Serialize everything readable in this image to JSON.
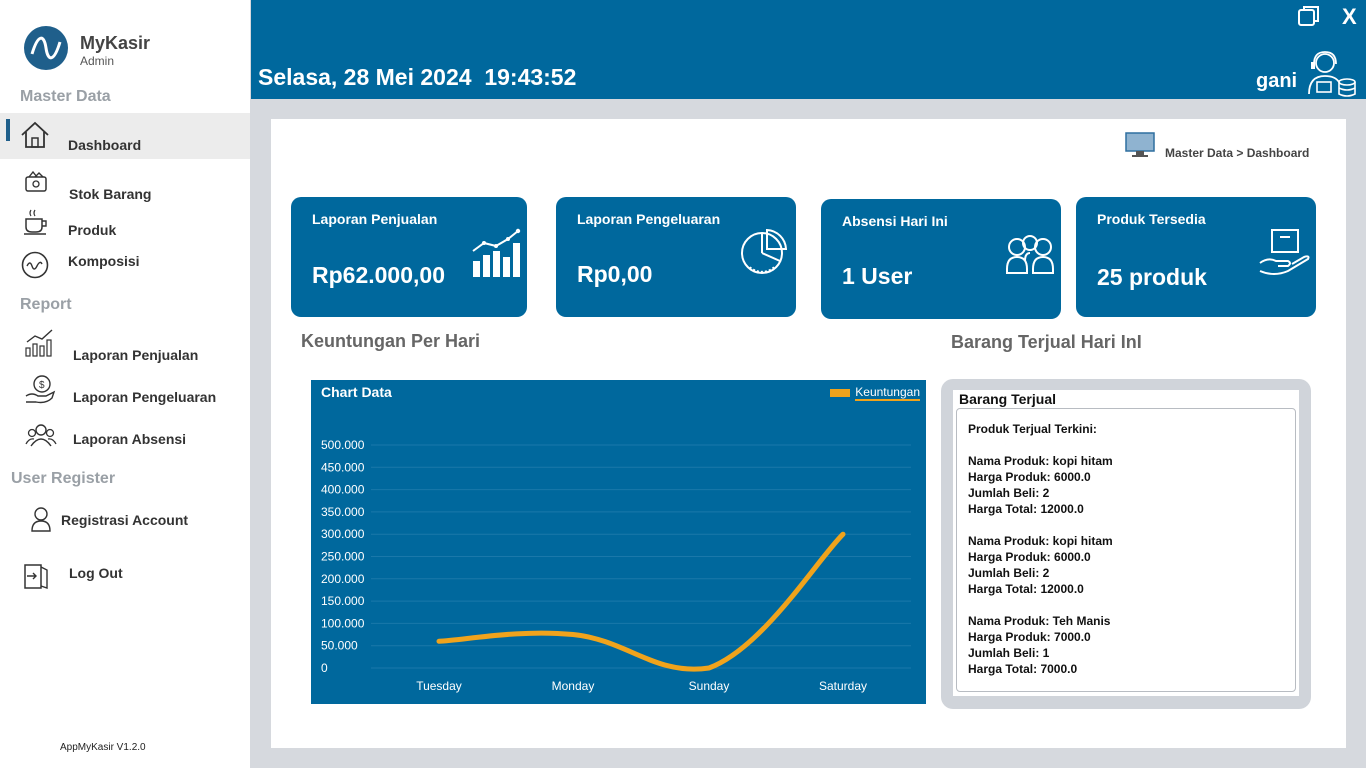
{
  "app": {
    "name": "MyKasir",
    "role": "Admin",
    "version": "AppMyKasir V1.2.0"
  },
  "sidebar": {
    "sections": {
      "master": "Master Data",
      "report": "Report",
      "user": "User Register"
    },
    "items": [
      {
        "label": "Dashboard",
        "icon": "home-icon",
        "active": true
      },
      {
        "label": "Stok Barang",
        "icon": "stock-icon"
      },
      {
        "label": "Produk",
        "icon": "coffee-icon"
      },
      {
        "label": "Komposisi",
        "icon": "wave-icon"
      },
      {
        "label": "Laporan Penjualan",
        "icon": "bar-chart-icon"
      },
      {
        "label": "Laporan Pengeluaran",
        "icon": "money-hand-icon"
      },
      {
        "label": "Laporan Absensi",
        "icon": "people-icon"
      },
      {
        "label": "Registrasi Account",
        "icon": "user-icon"
      },
      {
        "label": "Log Out",
        "icon": "logout-icon"
      }
    ]
  },
  "header": {
    "datetime": "Selasa, 28 Mei 2024  19:43:52",
    "username": "gani",
    "close_label": "X"
  },
  "breadcrumb": "Master Data > Dashboard",
  "cards": [
    {
      "title": "Laporan Penjualan",
      "value": "Rp62.000,00",
      "icon": "sales-chart-icon"
    },
    {
      "title": "Laporan Pengeluaran",
      "value": "Rp0,00",
      "icon": "pie-chart-icon"
    },
    {
      "title": "Absensi Hari Ini",
      "value": "1 User",
      "icon": "users-icon"
    },
    {
      "title": "Produk Tersedia",
      "value": "25 produk",
      "icon": "box-hand-icon"
    }
  ],
  "headings": {
    "profit": "Keuntungan Per Hari",
    "sold": "Barang Terjual Hari InI"
  },
  "chart_data": {
    "type": "line",
    "title": "Chart Data",
    "series": [
      {
        "name": "Keuntungan",
        "values": [
          60000,
          75000,
          0,
          300000
        ],
        "color": "#f0a31c"
      }
    ],
    "categories": [
      "Tuesday",
      "Monday",
      "Sunday",
      "Saturday"
    ],
    "y_ticks": [
      "500.000",
      "450.000",
      "400.000",
      "350.000",
      "300.000",
      "250.000",
      "200.000",
      "150.000",
      "100.000",
      "50.000",
      "0"
    ],
    "ylim": [
      0,
      500000
    ],
    "grid": true,
    "legend": "top-right"
  },
  "sold": {
    "title": "Barang Terjual",
    "header": "Produk Terjual Terkini:",
    "items": [
      {
        "nama": "Nama Produk: kopi hitam",
        "harga": "Harga Produk: 6000.0",
        "jumlah": "Jumlah Beli: 2",
        "total": "Harga Total: 12000.0"
      },
      {
        "nama": "Nama Produk: kopi hitam",
        "harga": "Harga Produk: 6000.0",
        "jumlah": "Jumlah Beli: 2",
        "total": "Harga Total: 12000.0"
      },
      {
        "nama": "Nama Produk: Teh Manis",
        "harga": "Harga Produk: 7000.0",
        "jumlah": "Jumlah Beli: 1",
        "total": "Harga Total: 7000.0"
      }
    ]
  }
}
